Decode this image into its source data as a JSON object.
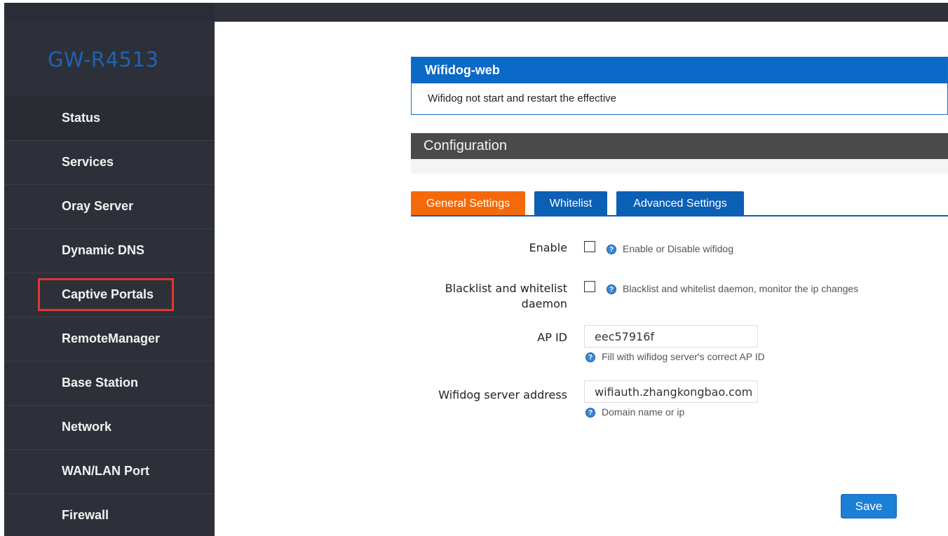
{
  "app": {
    "brand": "GW-R4513"
  },
  "sidebar": {
    "items": [
      {
        "label": "Status"
      },
      {
        "label": "Services"
      },
      {
        "label": "Oray Server"
      },
      {
        "label": "Dynamic DNS"
      },
      {
        "label": "Captive Portals"
      },
      {
        "label": "RemoteManager"
      },
      {
        "label": "Base Station"
      },
      {
        "label": "Network"
      },
      {
        "label": "WAN/LAN Port"
      },
      {
        "label": "Firewall"
      }
    ],
    "highlight_color": "#e03434"
  },
  "notice": {
    "title": "Wifidog-web",
    "message": "Wifidog not start and restart the effective"
  },
  "config": {
    "title": "Configuration"
  },
  "tabs": [
    {
      "label": "General Settings",
      "active": true
    },
    {
      "label": "Whitelist",
      "active": false
    },
    {
      "label": "Advanced Settings",
      "active": false
    }
  ],
  "form": {
    "enable": {
      "label": "Enable",
      "checked": false,
      "help": "Enable or Disable wifidog"
    },
    "daemon": {
      "label_line1": "Blacklist and whitelist",
      "label_line2": "daemon",
      "checked": false,
      "help": "Blacklist and whitelist daemon, monitor the ip changes"
    },
    "ap_id": {
      "label": "AP ID",
      "value": "eec57916f",
      "help": "Fill with wifidog server's correct AP ID"
    },
    "server": {
      "label": "Wifidog server address",
      "value": "wifiauth.zhangkongbao.com",
      "help": "Domain name or ip"
    }
  },
  "actions": {
    "save_label": "Save"
  },
  "colors": {
    "sidebar_bg": "#2d3039",
    "brand": "#1f63b2",
    "header_blue": "#0b69c7",
    "active_tab": "#f46a0b",
    "config_header": "#4a4a4a",
    "save_button": "#1c7fd6"
  }
}
